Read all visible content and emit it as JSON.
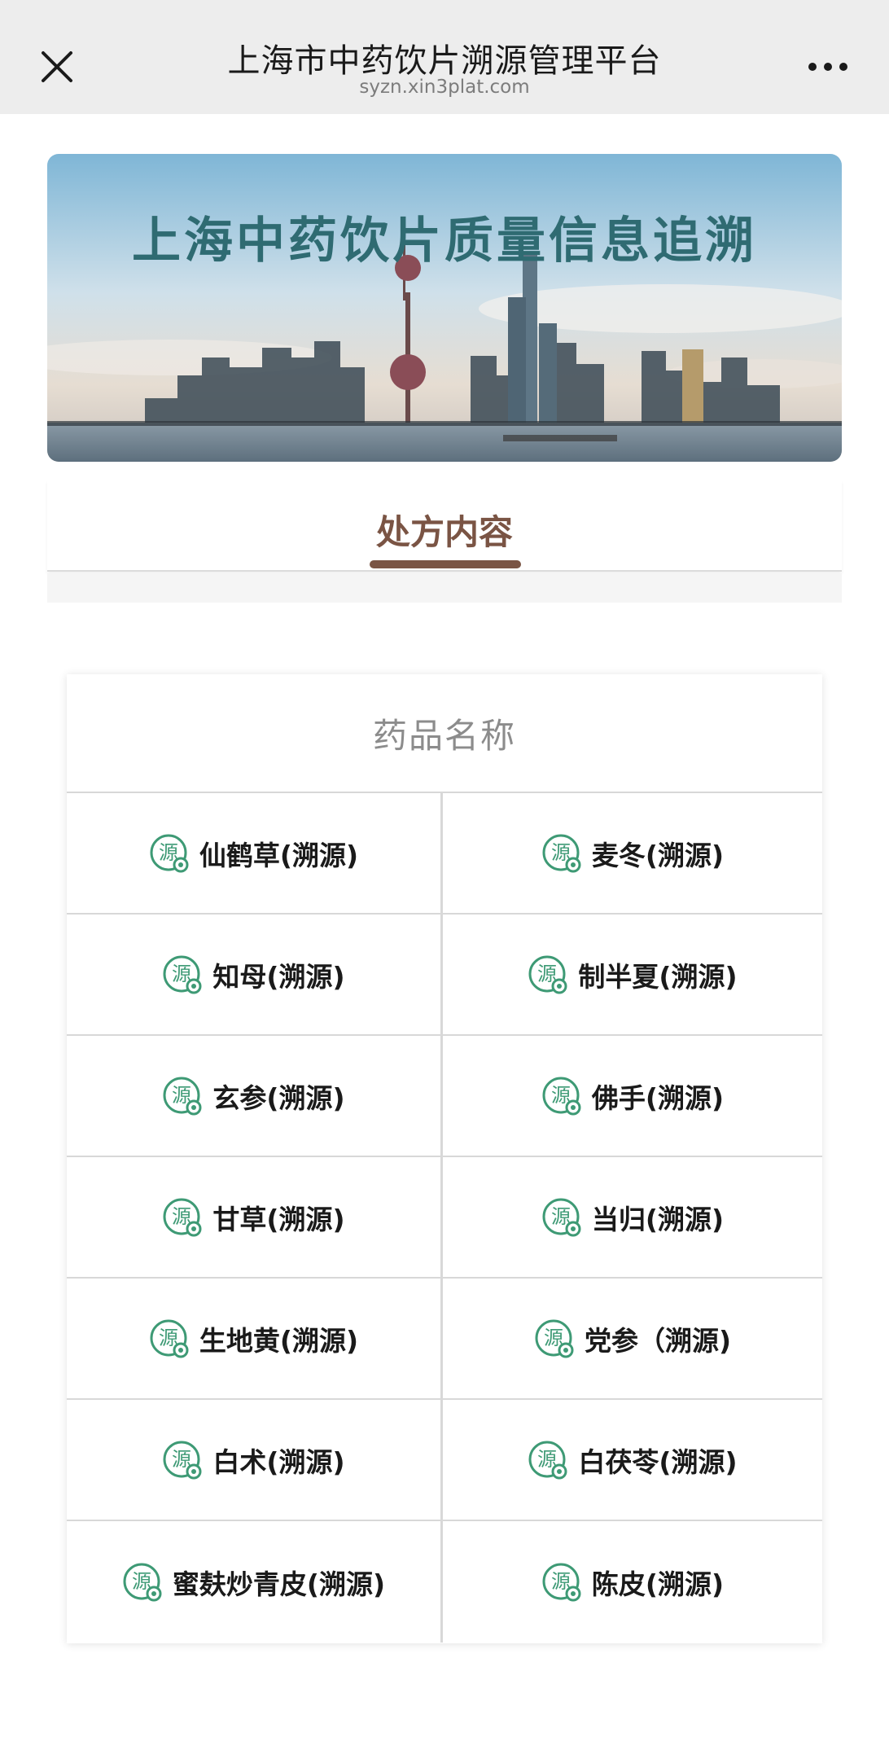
{
  "topbar": {
    "title": "上海市中药饮片溯源管理平台",
    "url": "syzn.xin3plat.com",
    "close_icon": "close-icon",
    "more_icon": "more-dots-icon"
  },
  "banner": {
    "title": "上海中药饮片质量信息追溯",
    "image": "shanghai-skyline-photo"
  },
  "tabs": {
    "active_label": "处方内容"
  },
  "table": {
    "header": "药品名称",
    "icon": "source-trace-icon",
    "icon_char": "源",
    "items": [
      "仙鹤草(溯源)",
      "麦冬(溯源)",
      "知母(溯源)",
      "制半夏(溯源)",
      "玄参(溯源)",
      "佛手(溯源)",
      "甘草(溯源)",
      "当归(溯源)",
      "生地黄(溯源)",
      "党参（溯源)",
      "白术(溯源)",
      "白茯苓(溯源)",
      "蜜麸炒青皮(溯源)",
      "陈皮(溯源)"
    ]
  },
  "colors": {
    "accent_brown": "#7a5444",
    "icon_green": "#3e9a75",
    "banner_title": "#2f6b72"
  }
}
